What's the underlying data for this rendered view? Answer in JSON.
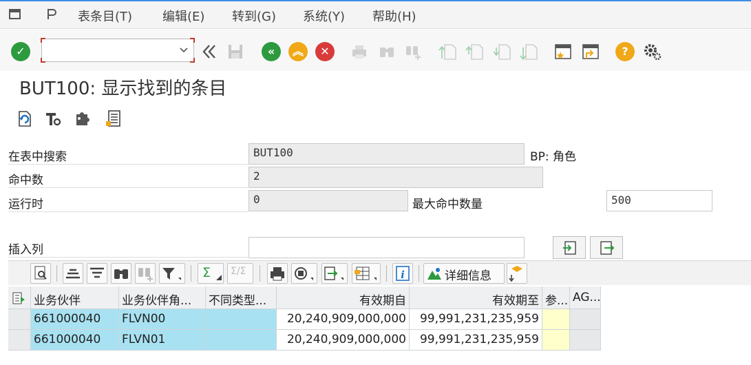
{
  "menu": {
    "items": [
      {
        "label": "表条目(T)"
      },
      {
        "label": "编辑(E)"
      },
      {
        "label": "转到(G)"
      },
      {
        "label": "系统(Y)"
      },
      {
        "label": "帮助(H)"
      }
    ]
  },
  "toolbar": {
    "command_value": "",
    "icons": [
      "check-icon",
      "back-double-icon",
      "save-icon",
      "back-icon",
      "exit-icon",
      "cancel-icon",
      "print-icon",
      "find-icon",
      "find-next-icon",
      "first-page-icon",
      "prev-page-icon",
      "next-page-icon",
      "last-page-icon",
      "create-session-icon",
      "shortcut-icon",
      "help-icon",
      "settings-icon"
    ]
  },
  "title": "BUT100: 显示找到的条目",
  "form": {
    "search_table_label": "在表中搜索",
    "search_table_value": "BUT100",
    "search_table_desc": "BP: 角色",
    "hits_label": "命中数",
    "hits_value": "2",
    "runtime_label": "运行时",
    "runtime_value": "0",
    "max_hits_label": "最大命中数量",
    "max_hits_value": "500",
    "insert_col_label": "插入列",
    "insert_col_value": ""
  },
  "alv_toolbar": {
    "details_label": "详细信息"
  },
  "grid": {
    "columns": [
      "业务伙伴",
      "业务伙伴角...",
      "不同类型...",
      "有效期自",
      "有效期至",
      "参...",
      "AG..."
    ],
    "rows": [
      [
        "661000040",
        "FLVN00",
        "",
        "20,240,909,000,000",
        "99,991,231,235,959",
        "",
        ""
      ],
      [
        "661000040",
        "FLVN01",
        "",
        "20,240,909,000,000",
        "99,991,231,235,959",
        "",
        ""
      ]
    ]
  },
  "colors": {
    "accent": "#3a8ee6",
    "key_cell": "#a8e2f2",
    "ok_green": "#2e9a3f",
    "warn_orange": "#f0a818",
    "error_red": "#d93a3a"
  }
}
